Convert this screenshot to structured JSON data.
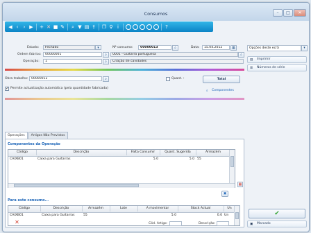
{
  "window": {
    "title": "Consumos"
  },
  "header": {
    "estado_label": "Estado:",
    "estado_value": "Fechado",
    "num_consumo_label": "Nº consumo:",
    "num_consumo_value": "00000013",
    "data_label": "Data:",
    "data_value": "15.04.2012",
    "ordem_label": "Ordem fabrico:",
    "ordem_value": "00000001",
    "ordem_desc": "0001 - Guitarra portuguesa",
    "operacao_label": "Operação:",
    "operacao_value": "1",
    "operacao_desc": "Criação de cavidades",
    "obra_label": "Obra trabalho:",
    "obra_value": "00000012",
    "qtd_label": "Quant. :",
    "auto_update_label": "Permite actualização automática (pela quantidade fabricada)",
    "total_label": "Total",
    "componentes_label": "Componentes"
  },
  "side": {
    "dropdown_value": "Opções deste ecrã",
    "imprimir_label": "Imprimir",
    "numeros_serie_label": "Números de série",
    "marcado_label": "Marcado",
    "colors": {
      "ok_green": "#3aa63a"
    }
  },
  "tabs": [
    {
      "label": "Operações"
    },
    {
      "label": "Artigos Não Previstos"
    }
  ],
  "grid1": {
    "title": "Componentes da Operação",
    "columns": [
      "Código",
      "Descrição",
      "Falta Consumir",
      "Quant. Sugerida",
      "Armazém"
    ],
    "rows": [
      {
        "codigo": "CAIXB01",
        "descricao": "Caixa para Guitarras",
        "falta": "5.0",
        "sugerida": "5.0",
        "armazem": "55"
      }
    ]
  },
  "grid2": {
    "title": "Para este consumo...",
    "columns": [
      "Código",
      "Descrição",
      "Armazém",
      "Lote",
      "A movimentar",
      "Stock Actual",
      "Un"
    ],
    "rows": [
      {
        "codigo": "CAIXB01",
        "descricao": "Caixa para Guitarras",
        "armazem": "55",
        "lote": "",
        "movimentar": "5.0",
        "stock": "0.0",
        "un": "Un"
      }
    ]
  },
  "footer": {
    "cod_artigo_label": "Cód. Artigo:",
    "descricao_label": "Descrição:"
  },
  "colors": {
    "toolbar": "#0b84c6",
    "section_title": "#1b64b8",
    "delete_red": "#d03a2a"
  }
}
